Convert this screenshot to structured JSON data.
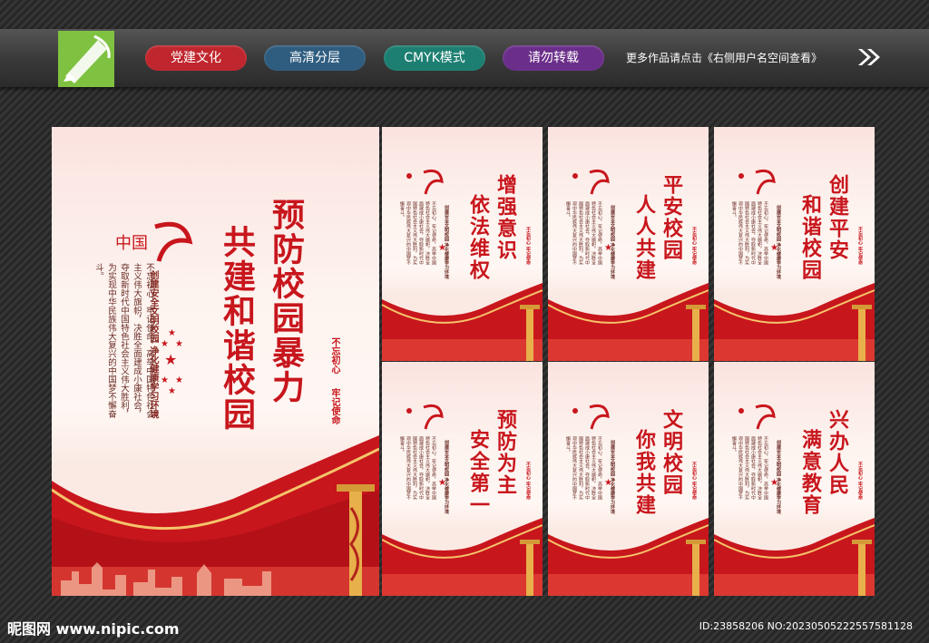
{
  "header": {
    "tags": [
      {
        "label": "党建文化",
        "color": "#c0262e"
      },
      {
        "label": "高清分层",
        "color": "#2f5d80"
      },
      {
        "label": "CMYK模式",
        "color": "#1d7f72"
      },
      {
        "label": "请勿转载",
        "color": "#6b2e8a"
      }
    ],
    "note": "更多作品请点击《右侧用户名空间查看》"
  },
  "colors": {
    "accent_red": "#c8161d",
    "logo_green": "#7fc241"
  },
  "main_poster": {
    "title_col1": "预防校园暴力",
    "title_col2": "共建和谐校园",
    "subtitle": "创建安全文明校园 净化健康学习环境",
    "body": "不忘初心，牢记使命，高举中国特色社会主义伟大旗帜，决胜全面建成小康社会，夺取新时代中国特色社会主义伟大胜利，为实现中华民族伟大复兴的中国梦不懈奋斗。",
    "motto_a": "不忘初心",
    "motto_b": "牢记使命"
  },
  "small_posters": [
    {
      "col1": "增强意识",
      "col2": "依法维权"
    },
    {
      "col1": "平安校园",
      "col2": "人人共建"
    },
    {
      "col1": "创建平安",
      "col2": "和谐校园"
    },
    {
      "col1": "预防为主",
      "col2": "安全第一"
    },
    {
      "col1": "文明校园",
      "col2": "你我共建"
    },
    {
      "col1": "兴办人民",
      "col2": "满意教育"
    }
  ],
  "small_text": {
    "subtitle": "创建安全文明校园 净化健康学习环境",
    "body": "不忘初心，牢记使命，高举中国特色社会主义伟大旗帜，决胜全面建成小康社会，夺取新时代中国特色社会主义伟大胜利，为实现中华民族伟大复兴的中国梦不懈奋斗。",
    "motto_a": "不忘初心",
    "motto_b": "牢记使命"
  },
  "footer": {
    "watermark": "昵图网 www.nipic.com",
    "image_id": "ID:23858206 NO:20230505222557581128"
  }
}
